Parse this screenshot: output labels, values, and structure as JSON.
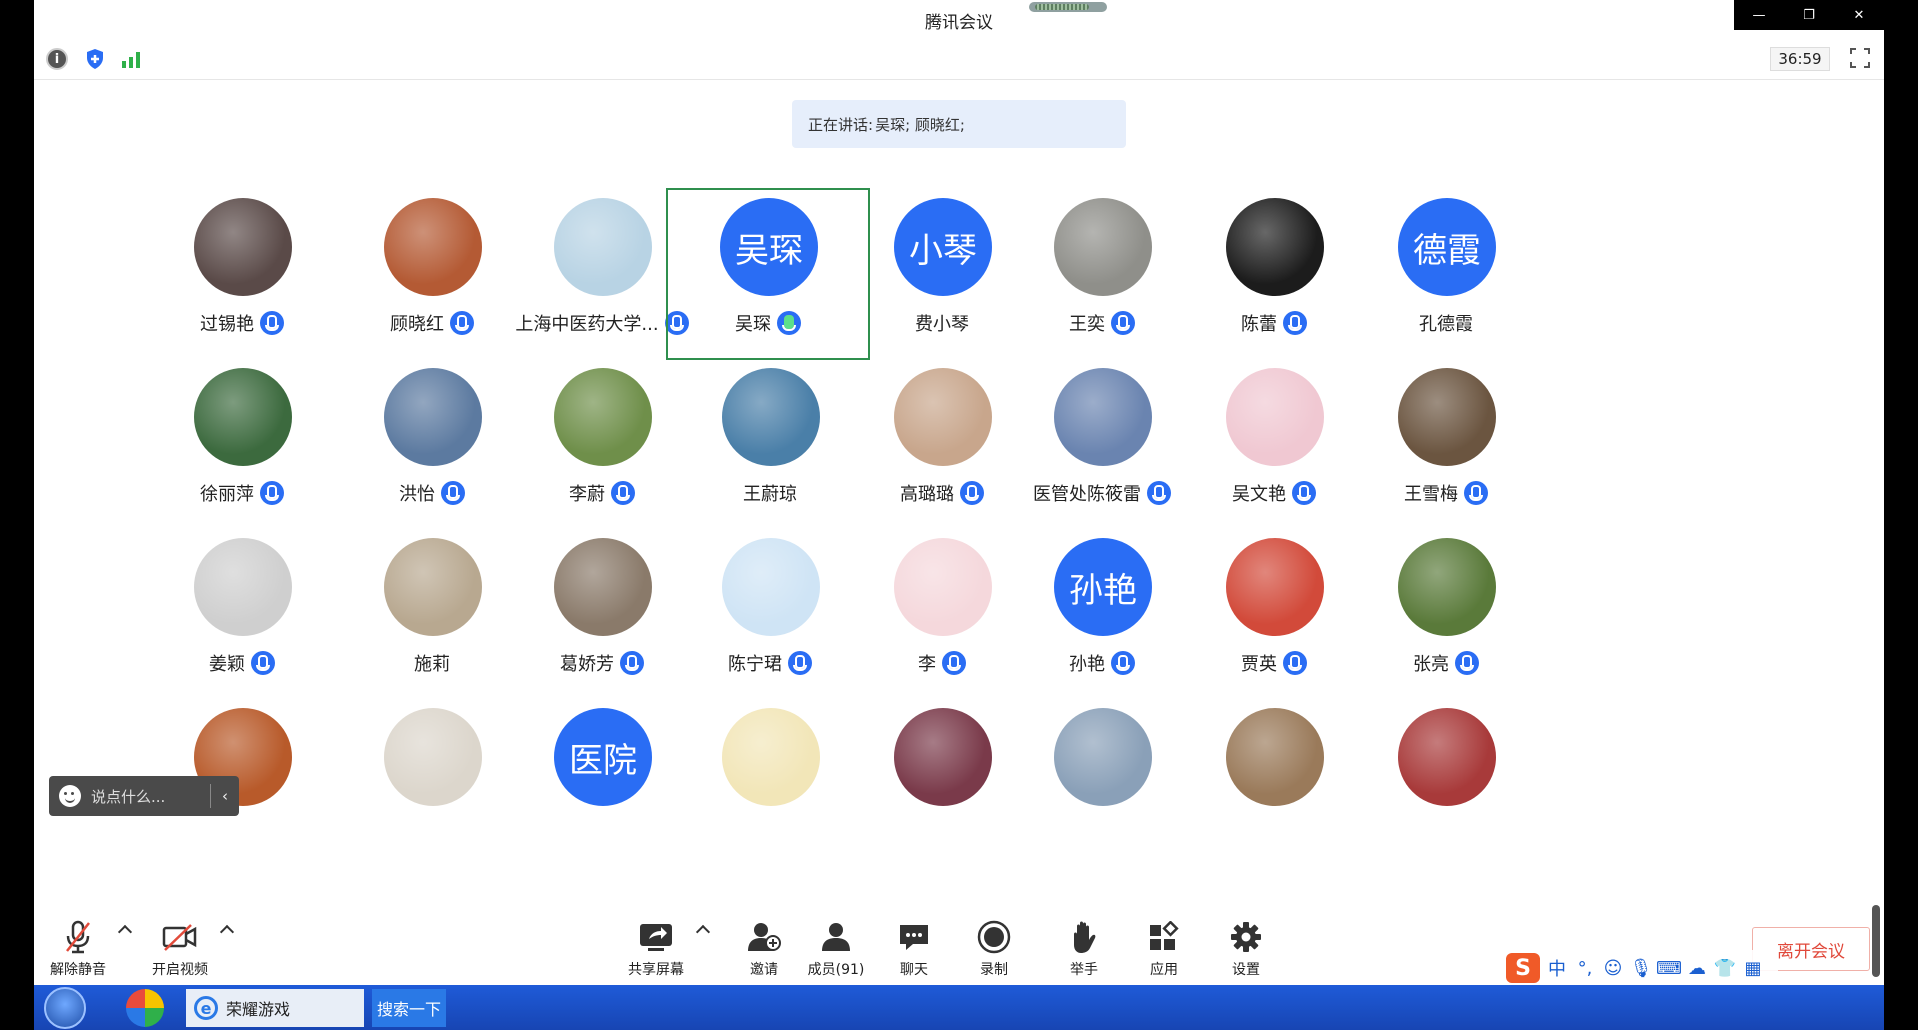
{
  "window": {
    "title": "腾讯会议",
    "controls": [
      "—",
      "❐",
      "✕"
    ]
  },
  "toolbar": {
    "info_icon_glyph": "i",
    "timer": "36:59"
  },
  "speaking": {
    "prefix": "正在讲话:",
    "names": "吴琛; 顾晓红;"
  },
  "participants": [
    {
      "name": "过锡艳",
      "avatar": "photo",
      "color": "#5a4a48",
      "mic": true
    },
    {
      "name": "顾晓红",
      "avatar": "photo",
      "color": "#b45a34",
      "mic": true
    },
    {
      "name": "上海中医药大学...",
      "avatar": "photo",
      "color": "#b8d3e4",
      "mic": true
    },
    {
      "name": "吴琛",
      "avatar": "text",
      "initials": "吴琛",
      "mic": true,
      "active": true
    },
    {
      "name": "费小琴",
      "avatar": "text",
      "initials": "小琴",
      "mic": false
    },
    {
      "name": "王奕",
      "avatar": "photo",
      "color": "#8f8f8a",
      "mic": true
    },
    {
      "name": "陈蕾",
      "avatar": "photo",
      "color": "#1c1c1c",
      "mic": true
    },
    {
      "name": "孔德霞",
      "avatar": "text",
      "initials": "德霞",
      "mic": false
    },
    {
      "name": "徐丽萍",
      "avatar": "photo",
      "color": "#3c6a3e",
      "mic": true
    },
    {
      "name": "洪怡",
      "avatar": "photo",
      "color": "#5c7aa0",
      "mic": true
    },
    {
      "name": "李蔚",
      "avatar": "photo",
      "color": "#6f8f4a",
      "mic": true
    },
    {
      "name": "王蔚琼",
      "avatar": "photo",
      "color": "#4a7fa8",
      "mic": false
    },
    {
      "name": "高璐璐",
      "avatar": "photo",
      "color": "#c8a68c",
      "mic": true
    },
    {
      "name": "医管处陈筱雷",
      "avatar": "photo",
      "color": "#6a84b0",
      "mic": true
    },
    {
      "name": "吴文艳",
      "avatar": "photo",
      "color": "#f0c8d2",
      "mic": true
    },
    {
      "name": "王雪梅",
      "avatar": "photo",
      "color": "#6b5540",
      "mic": true
    },
    {
      "name": "姜颖",
      "avatar": "photo",
      "color": "#cfcfcf",
      "mic": true
    },
    {
      "name": "施莉",
      "avatar": "photo",
      "color": "#b8a890",
      "mic": false
    },
    {
      "name": "葛娇芳",
      "avatar": "photo",
      "color": "#8a7a6a",
      "mic": true
    },
    {
      "name": "陈宁珺",
      "avatar": "photo",
      "color": "#cfe4f5",
      "mic": true
    },
    {
      "name": "李",
      "avatar": "photo",
      "color": "#f5d8dc",
      "mic": true
    },
    {
      "name": "孙艳",
      "avatar": "text",
      "initials": "孙艳",
      "mic": true
    },
    {
      "name": "贾英",
      "avatar": "photo",
      "color": "#d24a3a",
      "mic": true
    },
    {
      "name": "张亮",
      "avatar": "photo",
      "color": "#5a7a3a",
      "mic": true
    },
    {
      "name": "",
      "avatar": "photo",
      "color": "#b85a2a",
      "mic": true
    },
    {
      "name": "",
      "avatar": "photo",
      "color": "#dcd6cc",
      "mic": true
    },
    {
      "name": "",
      "avatar": "text",
      "initials": "医院",
      "mic": true
    },
    {
      "name": "",
      "avatar": "photo",
      "color": "#f2e6b8",
      "mic": true
    },
    {
      "name": "",
      "avatar": "photo",
      "color": "#7a3a4a",
      "mic": true
    },
    {
      "name": "",
      "avatar": "photo",
      "color": "#8aa0b8",
      "mic": true
    },
    {
      "name": "",
      "avatar": "photo",
      "color": "#9a7a5a",
      "mic": true
    },
    {
      "name": "",
      "avatar": "photo",
      "color": "#a83a3a",
      "mic": true
    }
  ],
  "chat": {
    "placeholder": "说点什么..."
  },
  "bottom": {
    "unmute": "解除静音",
    "video": "开启视频",
    "share": "共享屏幕",
    "invite": "邀请",
    "members": "成员(91)",
    "chat": "聊天",
    "record": "录制",
    "raise_hand": "举手",
    "apps": "应用",
    "settings": "设置",
    "leave": "离开会议"
  },
  "ime": {
    "logo": "S",
    "mode": "中",
    "punct": "°,"
  },
  "taskbar": {
    "ie_label": "荣耀游戏",
    "search_label": "搜索一下"
  }
}
